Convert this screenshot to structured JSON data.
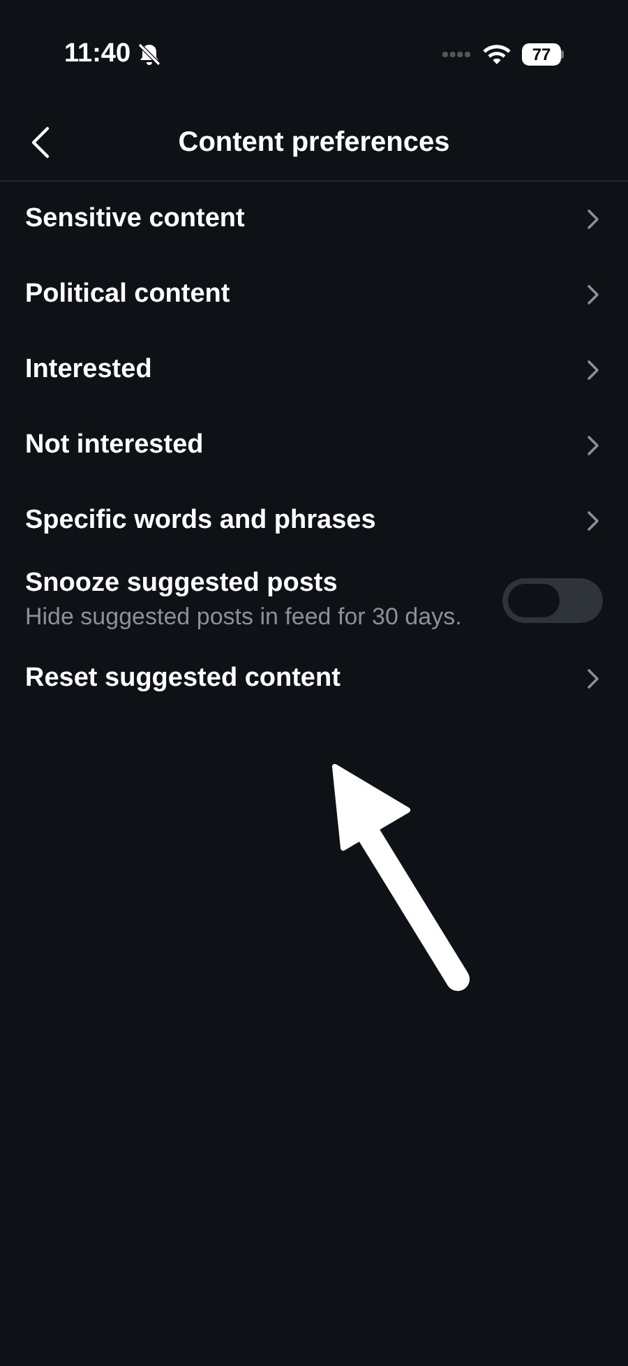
{
  "status_bar": {
    "time": "11:40",
    "battery": "77"
  },
  "header": {
    "title": "Content preferences"
  },
  "items": [
    {
      "kind": "link",
      "label": "Sensitive content"
    },
    {
      "kind": "link",
      "label": "Political content"
    },
    {
      "kind": "link",
      "label": "Interested"
    },
    {
      "kind": "link",
      "label": "Not interested"
    },
    {
      "kind": "link",
      "label": "Specific words and phrases"
    },
    {
      "kind": "toggle",
      "label": "Snooze suggested posts",
      "description": "Hide suggested posts in feed for 30 days.",
      "on": false
    },
    {
      "kind": "link",
      "label": "Reset suggested content"
    }
  ]
}
